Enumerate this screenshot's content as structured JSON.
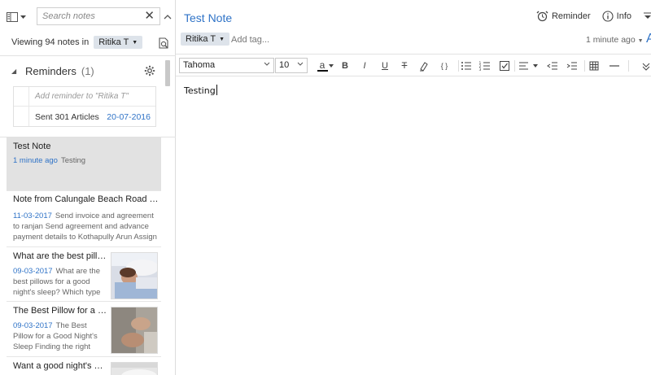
{
  "sidebar": {
    "search": {
      "placeholder": "Search notes",
      "value": ""
    },
    "viewing": {
      "prefix": "Viewing 94 notes in",
      "notebook": "Ritika T"
    },
    "reminders": {
      "title": "Reminders",
      "count": "(1)",
      "add_placeholder": "Add reminder to \"Ritika T\"",
      "items": [
        {
          "label": "Sent 301 Articles",
          "date": "20-07-2016"
        }
      ]
    },
    "notes": [
      {
        "title": "Test Note",
        "date": "1 minute ago",
        "snippet": "Testing",
        "selected": true
      },
      {
        "title": "Note from Calungale Beach Road in Bard...",
        "date": "11-03-2017",
        "snippet": "Send invoice and agreement to ranjan Send agreement and advance payment details to Kothapully Arun Assign new airline tr..."
      },
      {
        "title": "What are the best pillows...",
        "date": "09-03-2017",
        "snippet": "What are the best pillows for a good night's sleep? Which type of pillow s..."
      },
      {
        "title": "The Best Pillow for a Goo...",
        "date": "09-03-2017",
        "snippet": "The Best Pillow for a Good Night's Sleep Finding the right pillow depe..."
      },
      {
        "title": "Want a good night's slee..."
      }
    ]
  },
  "note": {
    "title": "Test Note",
    "reminder_label": "Reminder",
    "info_label": "Info",
    "notebook": "Ritika T",
    "add_tag_placeholder": "Add tag...",
    "updated": "1 minute ago",
    "body": "Testing"
  },
  "toolbar": {
    "font": "Tahoma",
    "size": "10",
    "color_letter": "a",
    "color_hex": "#111111",
    "bold": "B",
    "italic": "I",
    "underline": "U",
    "strike": "T",
    "code": "{ }"
  },
  "colors": {
    "accent": "#2f73c7",
    "selected_bg": "#e2e2e2",
    "pill_bg": "#dde3ea"
  }
}
